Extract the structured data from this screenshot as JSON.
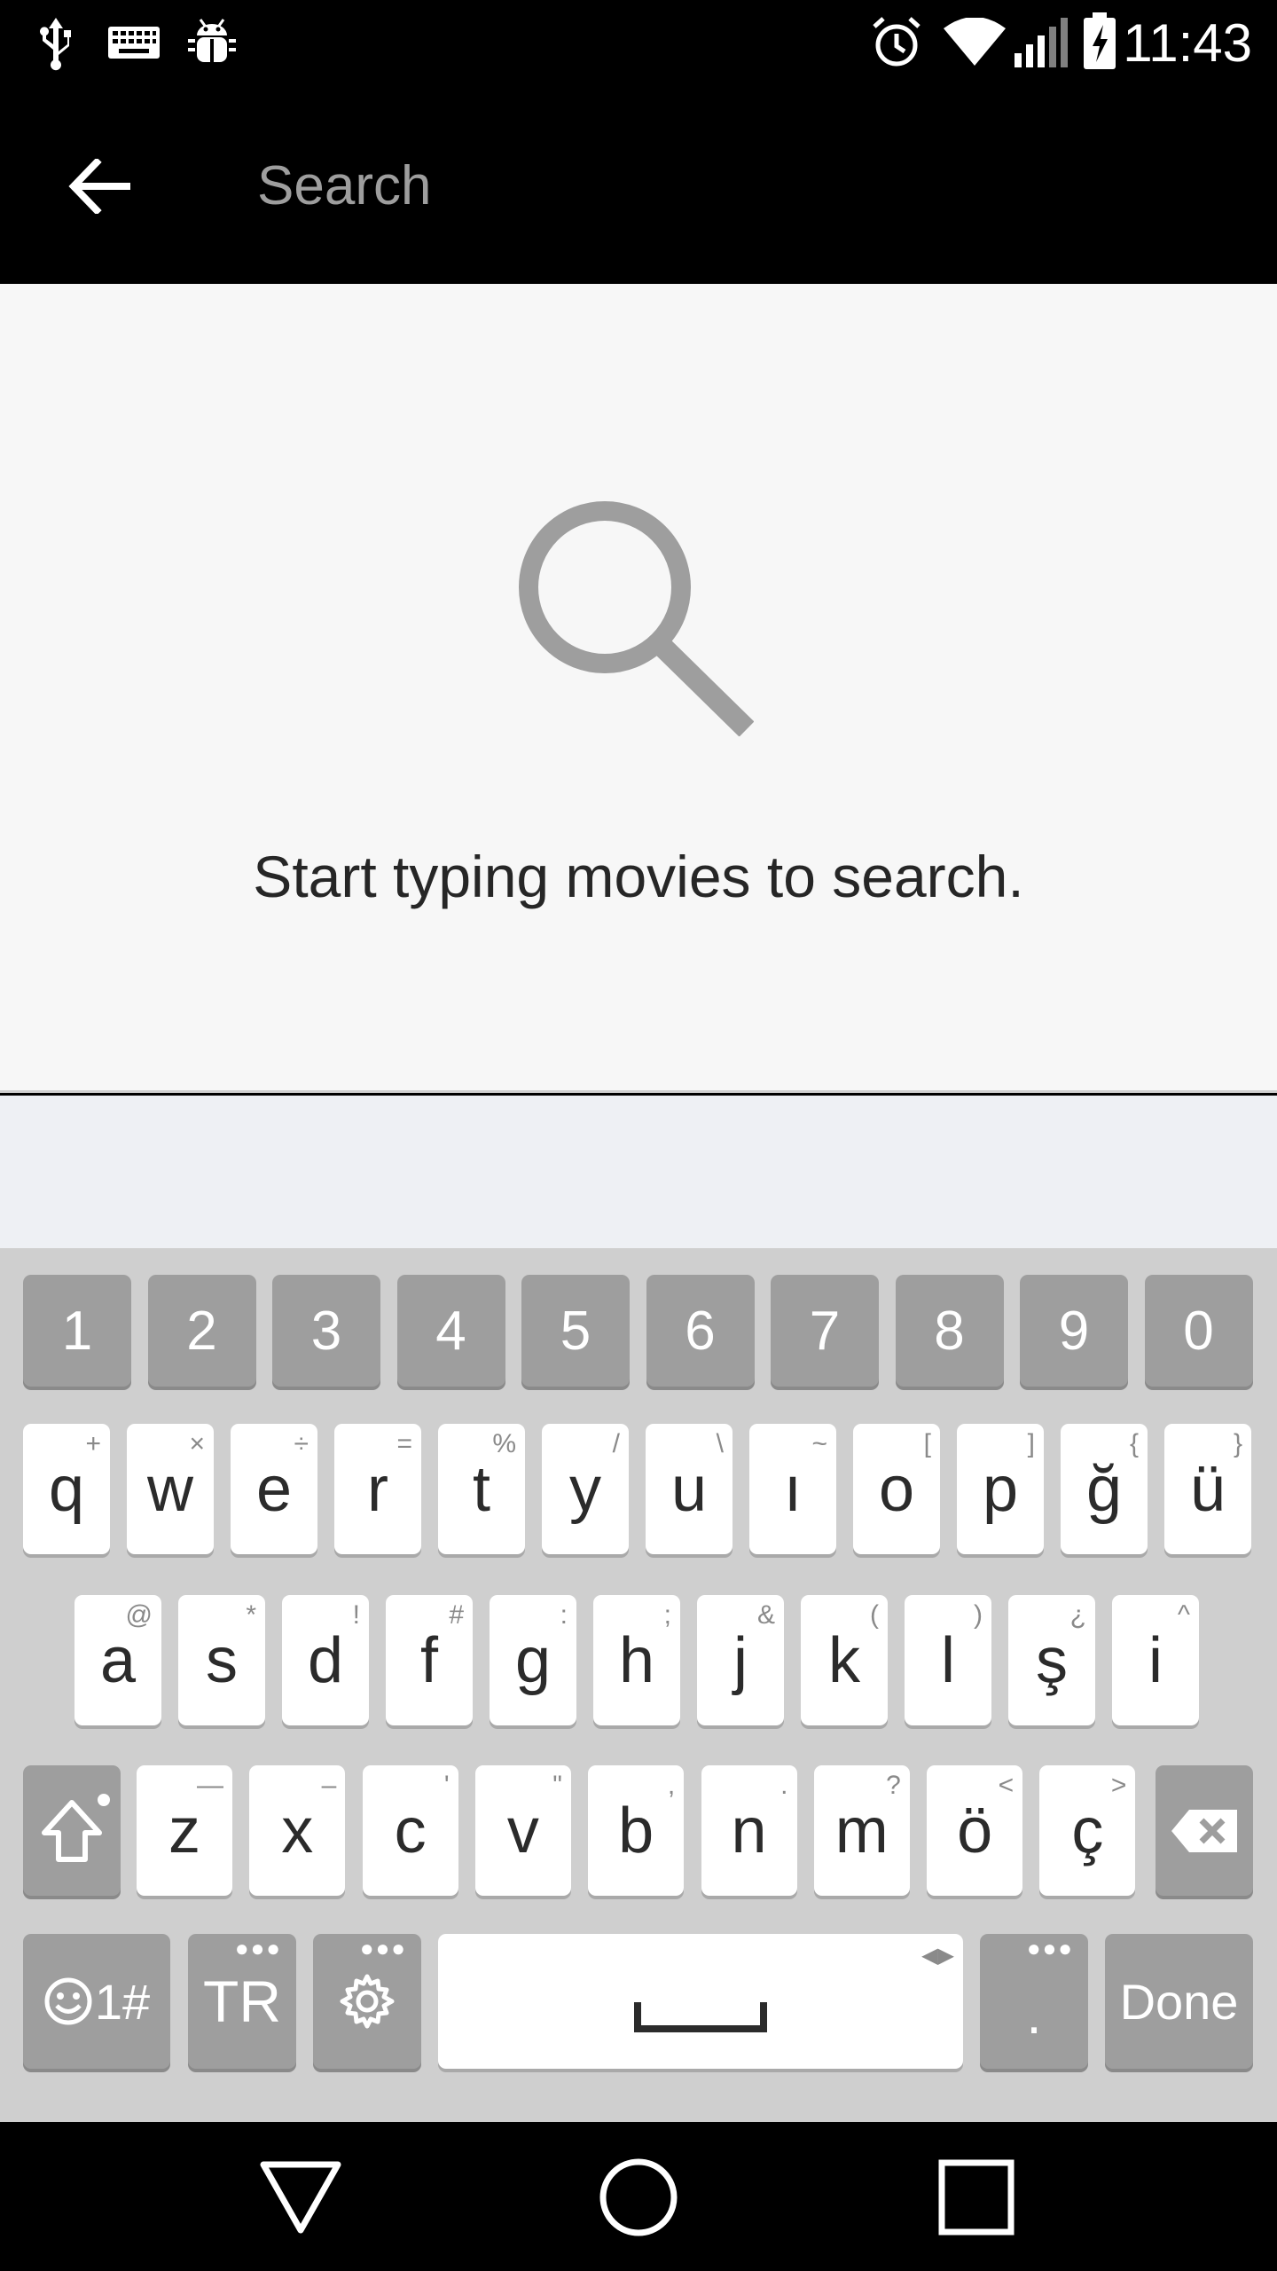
{
  "status_bar": {
    "time": "11:43",
    "icons": [
      "usb-icon",
      "keyboard-icon",
      "android-debug-icon",
      "alarm-icon",
      "wifi-icon",
      "signal-icon",
      "battery-charging-icon"
    ]
  },
  "toolbar": {
    "back_icon": "arrow-left-icon",
    "search_placeholder": "Search",
    "search_value": ""
  },
  "empty_state": {
    "icon": "search-icon",
    "message": "Start typing movies to search."
  },
  "keyboard": {
    "number_row": [
      "1",
      "2",
      "3",
      "4",
      "5",
      "6",
      "7",
      "8",
      "9",
      "0"
    ],
    "row1": [
      {
        "key": "q",
        "hint": "+"
      },
      {
        "key": "w",
        "hint": "×"
      },
      {
        "key": "e",
        "hint": "÷"
      },
      {
        "key": "r",
        "hint": "="
      },
      {
        "key": "t",
        "hint": "%"
      },
      {
        "key": "y",
        "hint": "/"
      },
      {
        "key": "u",
        "hint": "\\"
      },
      {
        "key": "ı",
        "hint": "~"
      },
      {
        "key": "o",
        "hint": "["
      },
      {
        "key": "p",
        "hint": "]"
      },
      {
        "key": "ğ",
        "hint": "{"
      },
      {
        "key": "ü",
        "hint": "}"
      }
    ],
    "row2": [
      {
        "key": "a",
        "hint": "@"
      },
      {
        "key": "s",
        "hint": "*"
      },
      {
        "key": "d",
        "hint": "!"
      },
      {
        "key": "f",
        "hint": "#"
      },
      {
        "key": "g",
        "hint": ":"
      },
      {
        "key": "h",
        "hint": ";"
      },
      {
        "key": "j",
        "hint": "&"
      },
      {
        "key": "k",
        "hint": "("
      },
      {
        "key": "l",
        "hint": ")"
      },
      {
        "key": "ş",
        "hint": "¿"
      },
      {
        "key": "i",
        "hint": "^"
      }
    ],
    "row3": [
      {
        "key": "z",
        "hint": "—"
      },
      {
        "key": "x",
        "hint": "–"
      },
      {
        "key": "c",
        "hint": "'"
      },
      {
        "key": "v",
        "hint": "\""
      },
      {
        "key": "b",
        "hint": ","
      },
      {
        "key": "n",
        "hint": "."
      },
      {
        "key": "m",
        "hint": "?"
      },
      {
        "key": "ö",
        "hint": "<"
      },
      {
        "key": "ç",
        "hint": ">"
      }
    ],
    "symbols_label": "1#",
    "language_label": "TR",
    "period_label": ".",
    "done_label": "Done"
  },
  "nav_bar": {
    "icons": [
      "back-triangle-icon",
      "home-circle-icon",
      "recents-square-icon"
    ]
  },
  "colors": {
    "status_bar_bg": "#000000",
    "toolbar_bg": "#000000",
    "content_bg": "#f7f7f7",
    "keyboard_bg": "#cfcfcf",
    "key_gray": "#9e9e9e",
    "icon_gray": "#9e9e9e"
  }
}
